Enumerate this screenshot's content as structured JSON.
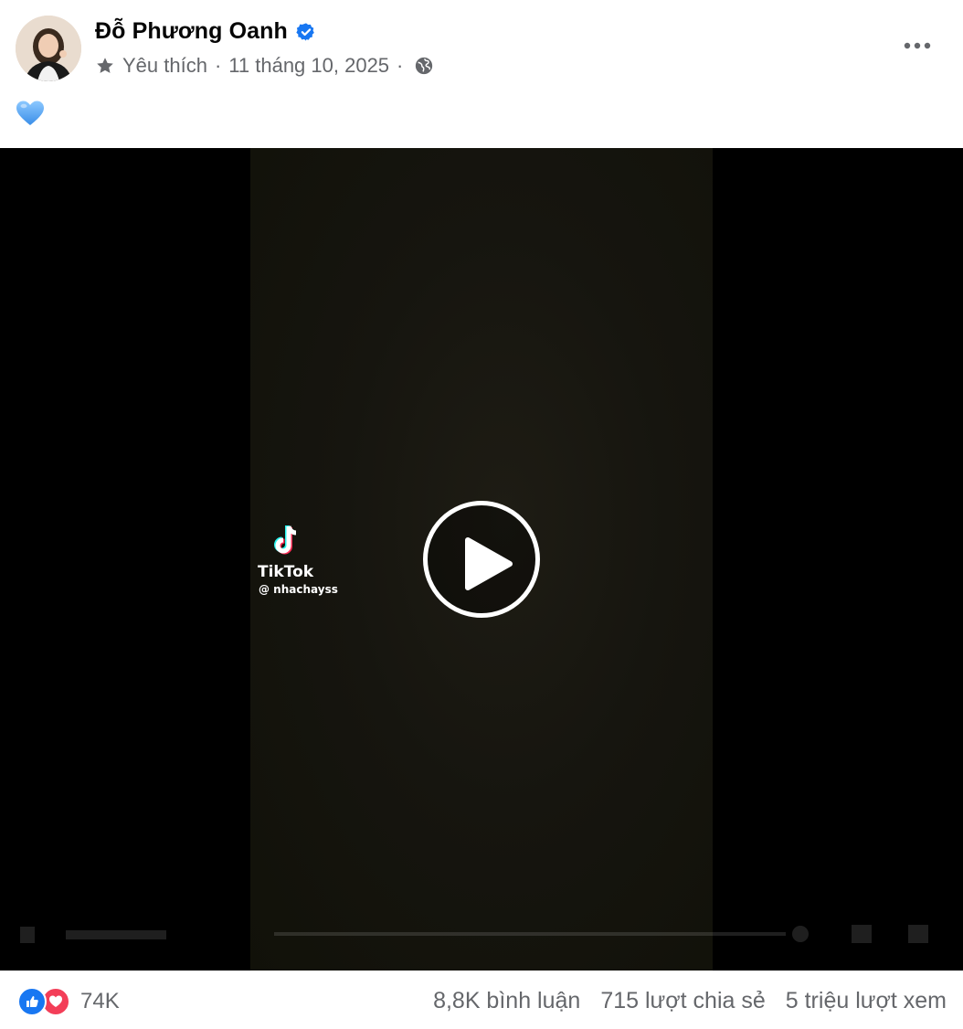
{
  "post": {
    "author": "Đỗ Phương Oanh",
    "audience_label": "Yêu thích",
    "separator": "·",
    "date": "11 tháng 10, 2025",
    "text_emoji": "💙"
  },
  "video": {
    "watermark_brand": "TikTok",
    "watermark_handle": "@ nhachayss"
  },
  "footer": {
    "reaction_count": "74K",
    "comments": "8,8K bình luận",
    "shares": "715 lượt chia sẻ",
    "views": "5 triệu lượt xem"
  },
  "icons": {
    "verified": "verified-badge-icon",
    "audience": "star-icon",
    "privacy": "globe-icon",
    "more": "more-options-icon",
    "play": "play-icon",
    "like": "like-reaction-icon",
    "love": "love-reaction-icon"
  },
  "colors": {
    "accent": "#1877f2",
    "love": "#f33e58",
    "secondary_text": "#65676b"
  }
}
